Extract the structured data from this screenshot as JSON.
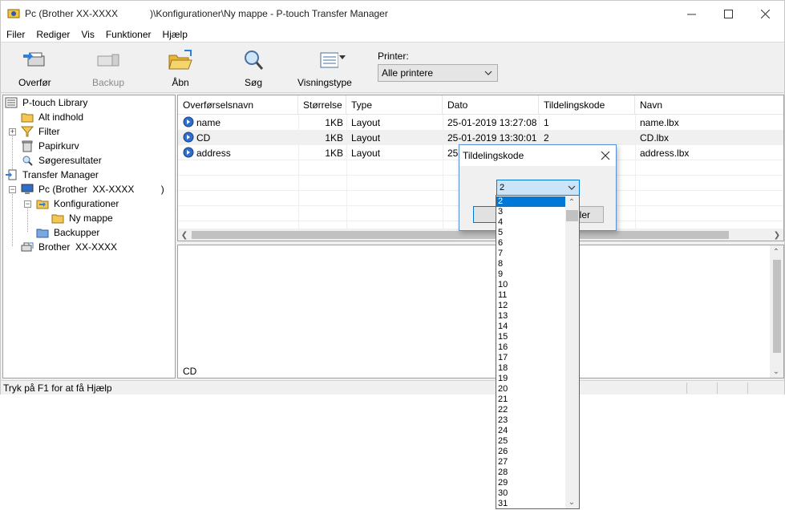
{
  "window": {
    "title": "Pc (Brother XX-XXXX            )\\Konfigurationer\\Ny mappe - P-touch Transfer Manager"
  },
  "menu": [
    "Filer",
    "Rediger",
    "Vis",
    "Funktioner",
    "Hjælp"
  ],
  "toolbar": {
    "transfer": "Overfør",
    "backup": "Backup",
    "open": "Åbn",
    "search": "Søg",
    "view": "Visningstype",
    "printer_label": "Printer:",
    "printer_value": "Alle printere"
  },
  "tree": {
    "items": [
      "P-touch Library",
      "Alt indhold",
      "Filter",
      "Papirkurv",
      "Søgeresultater",
      "Transfer Manager",
      "Pc (Brother  XX-XXXX          )",
      "Konfigurationer",
      "Ny mappe",
      "Backupper",
      "Brother  XX-XXXX"
    ]
  },
  "list": {
    "columns": [
      "Overførselsnavn",
      "Størrelse",
      "Type",
      "Dato",
      "Tildelingskode",
      "Navn"
    ],
    "rows": [
      [
        "name",
        "1KB",
        "Layout",
        "25-01-2019 13:27:08",
        "1",
        "name.lbx"
      ],
      [
        "CD",
        "1KB",
        "Layout",
        "25-01-2019 13:30:01",
        "2",
        "CD.lbx"
      ],
      [
        "address",
        "1KB",
        "Layout",
        "25-",
        "",
        "address.lbx"
      ]
    ]
  },
  "preview": {
    "name": "CD"
  },
  "status": {
    "text": "Tryk på F1 for at få Hjælp"
  },
  "dialog": {
    "title": "Tildelingskode",
    "selected": "2",
    "ok_label": "",
    "cancel_label": "ler"
  },
  "dropdown": {
    "options": [
      "2",
      "3",
      "4",
      "5",
      "6",
      "7",
      "8",
      "9",
      "10",
      "11",
      "12",
      "13",
      "14",
      "15",
      "16",
      "17",
      "18",
      "19",
      "20",
      "21",
      "22",
      "23",
      "24",
      "25",
      "26",
      "27",
      "28",
      "29",
      "30",
      "31"
    ],
    "highlighted": "2"
  },
  "colors": {
    "accent": "#0078d7",
    "selection": "#cce4f7"
  }
}
